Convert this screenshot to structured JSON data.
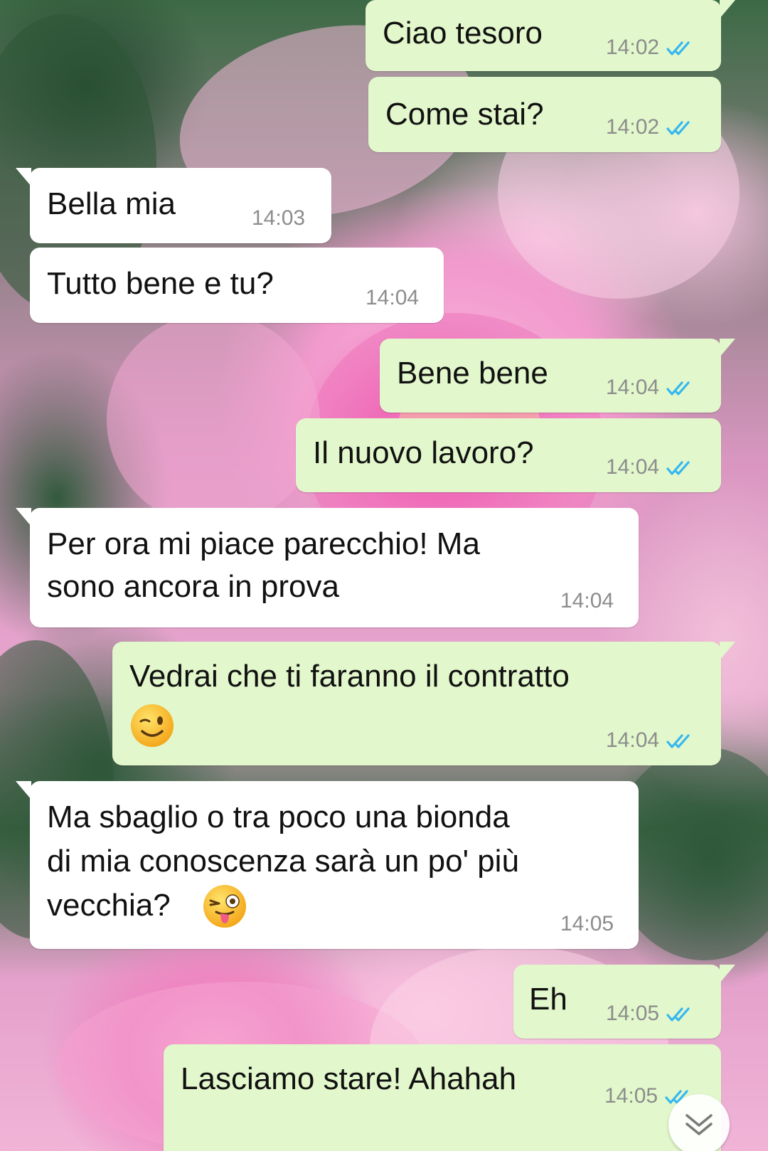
{
  "chat": {
    "messages": [
      {
        "direction": "out",
        "text": "Ciao tesoro",
        "time": "14:02",
        "status": "read"
      },
      {
        "direction": "out",
        "text": "Come stai?",
        "time": "14:02",
        "status": "read"
      },
      {
        "direction": "in",
        "text": "Bella mia",
        "time": "14:03"
      },
      {
        "direction": "in",
        "text": "Tutto bene e tu?",
        "time": "14:04"
      },
      {
        "direction": "out",
        "text": "Bene bene",
        "time": "14:04",
        "status": "read"
      },
      {
        "direction": "out",
        "text": "Il nuovo lavoro?",
        "time": "14:04",
        "status": "read"
      },
      {
        "direction": "in",
        "lines": [
          "Per ora mi piace parecchio! Ma",
          "sono ancora in prova"
        ],
        "time": "14:04"
      },
      {
        "direction": "out",
        "lines": [
          "Vedrai che ti faranno il contratto"
        ],
        "emoji": "winking-face-emoji",
        "time": "14:04",
        "status": "read"
      },
      {
        "direction": "in",
        "lines": [
          "Ma sbaglio o tra poco una bionda",
          "di mia conoscenza sarà un po' più",
          "vecchia?"
        ],
        "emoji": "winking-face-tongue-emoji",
        "time": "14:05"
      },
      {
        "direction": "out",
        "text": "Eh",
        "time": "14:05",
        "status": "read"
      },
      {
        "direction": "out",
        "text": "Lasciamo stare! Ahahah",
        "time": "14:05",
        "status": "read"
      }
    ]
  },
  "colors": {
    "outgoing_bubble": "#e2f7cb",
    "incoming_bubble": "#ffffff",
    "read_tick": "#34b7f1",
    "timestamp": "#8c8c8c"
  },
  "icons": {
    "read_receipt": "double-check-icon",
    "scroll_down": "chevron-double-down-icon"
  }
}
